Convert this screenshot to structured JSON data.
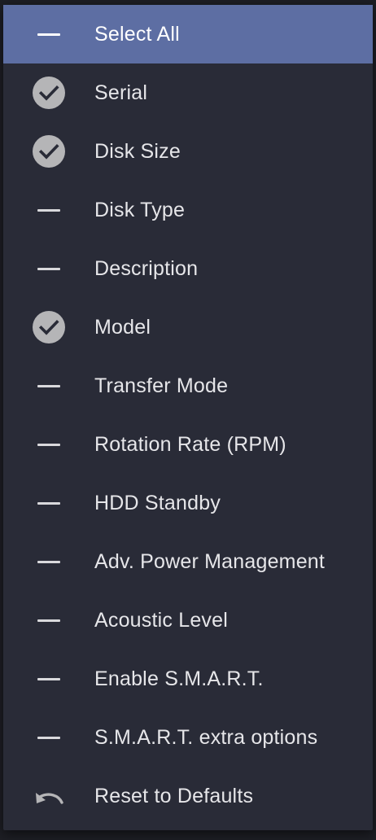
{
  "menu": {
    "items": [
      {
        "label": "Select All",
        "icon": "dash-icon",
        "highlight": true
      },
      {
        "label": "Serial",
        "icon": "check-circle-icon"
      },
      {
        "label": "Disk Size",
        "icon": "check-circle-icon"
      },
      {
        "label": "Disk Type",
        "icon": "dash-icon"
      },
      {
        "label": "Description",
        "icon": "dash-icon"
      },
      {
        "label": "Model",
        "icon": "check-circle-icon"
      },
      {
        "label": "Transfer Mode",
        "icon": "dash-icon"
      },
      {
        "label": "Rotation Rate (RPM)",
        "icon": "dash-icon"
      },
      {
        "label": "HDD Standby",
        "icon": "dash-icon"
      },
      {
        "label": "Adv. Power Management",
        "icon": "dash-icon"
      },
      {
        "label": "Acoustic Level",
        "icon": "dash-icon"
      },
      {
        "label": "Enable S.M.A.R.T.",
        "icon": "dash-icon"
      },
      {
        "label": "S.M.A.R.T. extra options",
        "icon": "dash-icon"
      },
      {
        "label": "Reset to Defaults",
        "icon": "undo-icon"
      }
    ]
  },
  "colors": {
    "highlight": "#5d6ea3",
    "menu_background": "#292b37",
    "check_circle": "#b5b5b7",
    "text": "#e6e6e9"
  }
}
